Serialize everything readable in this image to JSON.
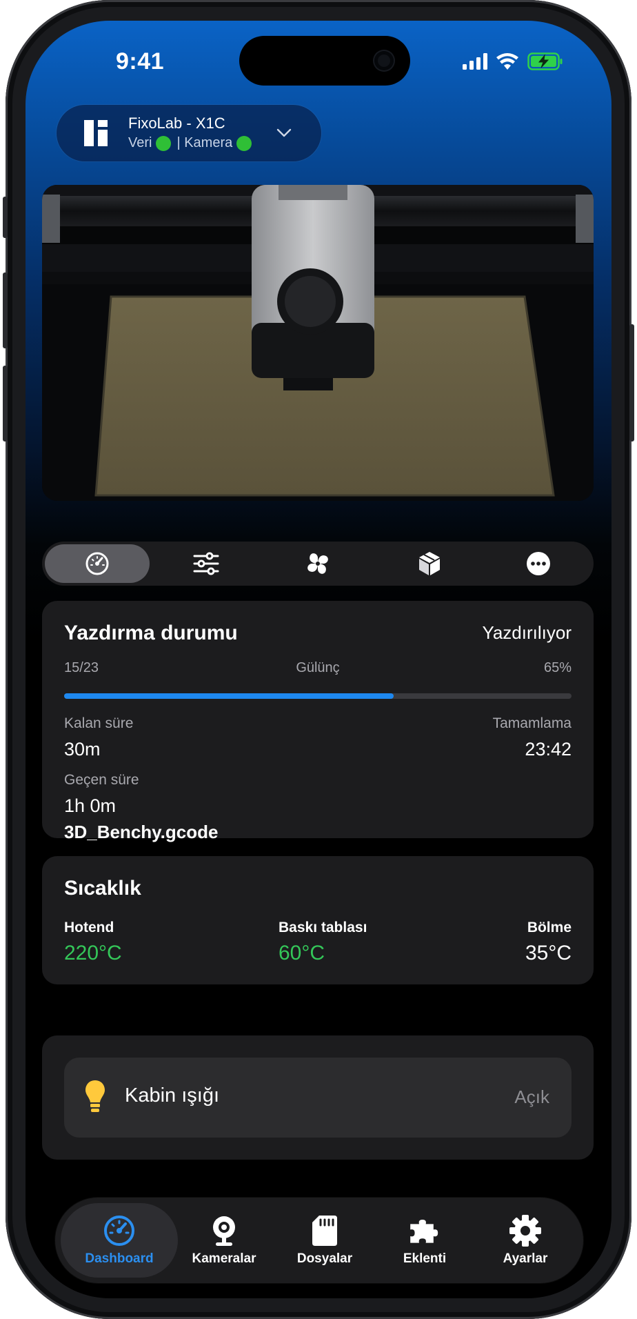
{
  "status_bar": {
    "time": "9:41"
  },
  "printer": {
    "name": "FixoLab - X1C",
    "data_label": "Veri",
    "camera_label": "| Kamera",
    "data_status_color": "#2fbf36",
    "camera_status_color": "#2fbf36"
  },
  "segments": [
    {
      "icon": "speedometer-icon",
      "active": true
    },
    {
      "icon": "sliders-icon",
      "active": false
    },
    {
      "icon": "fan-icon",
      "active": false
    },
    {
      "icon": "box-icon",
      "active": false
    },
    {
      "icon": "more-icon",
      "active": false
    }
  ],
  "print_status": {
    "title": "Yazdırma durumu",
    "state": "Yazdırılıyor",
    "layer": "15/23",
    "mode": "Gülünç",
    "percent_label": "65%",
    "progress": 0.65,
    "remaining_label": "Kalan süre",
    "remaining_value": "30m",
    "completion_label": "Tamamlama",
    "completion_value": "23:42",
    "elapsed_label": "Geçen süre",
    "elapsed_value": "1h 0m",
    "filename": "3D_Benchy.gcode"
  },
  "temperature": {
    "title": "Sıcaklık",
    "hotend_label": "Hotend",
    "hotend_value": "220°C",
    "bed_label": "Baskı tablası",
    "bed_value": "60°C",
    "chamber_label": "Bölme",
    "chamber_value": "35°C",
    "active_color": "#34c759"
  },
  "cabin_light": {
    "label": "Kabin ışığı",
    "state": "Açık"
  },
  "tabs": [
    {
      "label": "Dashboard",
      "icon": "dashboard-icon",
      "active": true
    },
    {
      "label": "Kameralar",
      "icon": "webcam-icon",
      "active": false
    },
    {
      "label": "Dosyalar",
      "icon": "sd-card-icon",
      "active": false
    },
    {
      "label": "Eklenti",
      "icon": "puzzle-icon",
      "active": false
    },
    {
      "label": "Ayarlar",
      "icon": "gear-icon",
      "active": false
    }
  ],
  "colors": {
    "accent": "#1e88ef",
    "background": "#000000",
    "card": "#1c1c1e"
  }
}
